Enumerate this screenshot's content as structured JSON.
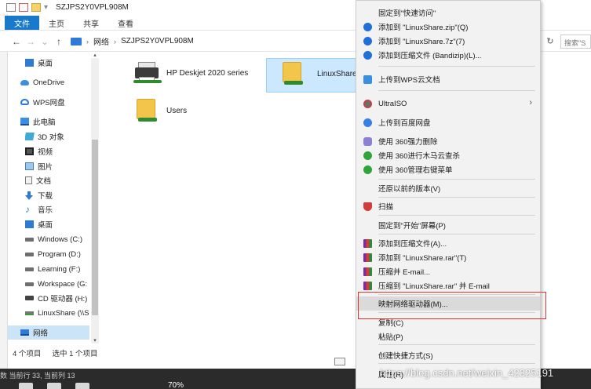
{
  "window": {
    "title": "SZJPS2Y0VPL908M"
  },
  "ribbon": {
    "tabs": [
      "文件",
      "主页",
      "共享",
      "查看"
    ]
  },
  "address": {
    "crumbs": [
      "网络",
      "SZJPS2Y0VPL908M"
    ],
    "search_placeholder": "搜索\"S"
  },
  "nav": {
    "items": [
      "桌面",
      "OneDrive",
      "WPS网盘",
      "此电脑",
      "3D 对象",
      "视频",
      "图片",
      "文档",
      "下载",
      "音乐",
      "桌面",
      "Windows (C:)",
      "Program (D:)",
      "Learning (F:)",
      "Workspace (G:",
      "CD 驱动器 (H:)",
      "LinuxShare (\\\\S",
      "网络"
    ]
  },
  "files": [
    {
      "name": "HP Deskjet 2020 series"
    },
    {
      "name": "LinuxShare"
    },
    {
      "name": "Users"
    }
  ],
  "status": {
    "count": "4 个项目",
    "selected": "选中 1 个项目"
  },
  "context_menu": {
    "items": [
      "固定到\"快速访问\"",
      "添加到 \"LinuxShare.zip\"(Q)",
      "添加到 \"LinuxShare.7z\"(7)",
      "添加到压缩文件 (Bandizip)(L)...",
      "上传到WPS云文档",
      "UltraISO",
      "上传到百度网盘",
      "使用 360强力删除",
      "使用 360进行木马云查杀",
      "使用 360管理右键菜单",
      "还原以前的版本(V)",
      "扫描",
      "固定到\"开始\"屏幕(P)",
      "添加到压缩文件(A)...",
      "添加到 \"LinuxShare.rar\"(T)",
      "压缩并 E-mail...",
      "压缩到 \"LinuxShare.rar\" 并 E-mail",
      "映射网络驱动器(M)...",
      "复制(C)",
      "粘贴(P)",
      "创建快捷方式(S)",
      "属性(R)"
    ]
  },
  "bottom": {
    "status": "数 当前行 33, 当前列 13",
    "zoom": "70%"
  },
  "watermark": "https://blog.csdn.net/weixin_42325191",
  "colors": {
    "accent": "#1979ca",
    "selection": "#cce8ff",
    "highlight": "#e03030"
  }
}
